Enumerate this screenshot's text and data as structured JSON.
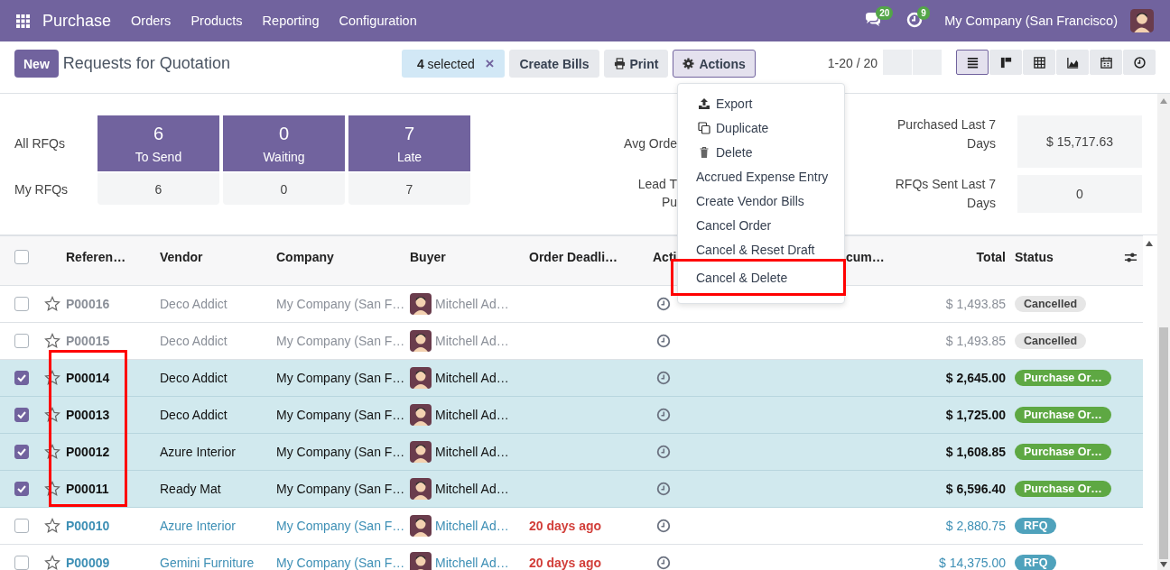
{
  "navbar": {
    "app": "Purchase",
    "menus": [
      "Orders",
      "Products",
      "Reporting",
      "Configuration"
    ],
    "messages_count": "20",
    "activities_count": "9",
    "company": "My Company (San Francisco)"
  },
  "control_panel": {
    "new_button": "New",
    "title": "Requests for Quotation",
    "selection": {
      "text": "**4** selected",
      "clear": "×"
    },
    "buttons": [
      {
        "label": "Create Bills",
        "kind": "plain",
        "open": false
      },
      {
        "label": "Print",
        "kind": "print",
        "open": false
      },
      {
        "label": "Actions",
        "kind": "actions",
        "open": true
      }
    ],
    "pager": "1-20 / 20",
    "views": [
      {
        "kind": "list",
        "selected": true
      },
      {
        "kind": "kanban",
        "selected": false
      },
      {
        "kind": "pivot",
        "selected": false
      },
      {
        "kind": "graph",
        "selected": false
      },
      {
        "kind": "calendar",
        "selected": false
      },
      {
        "kind": "activity",
        "selected": false
      }
    ]
  },
  "actions_menu": {
    "items": [
      {
        "label": "Export",
        "kind": "export",
        "marked": false
      },
      {
        "label": "Duplicate",
        "kind": "duplicate",
        "marked": false
      },
      {
        "label": "Delete",
        "kind": "delete",
        "marked": false
      },
      {
        "label": "Accrued Expense Entry",
        "kind": "plain",
        "marked": false
      },
      {
        "label": "Create Vendor Bills",
        "kind": "plain",
        "marked": false
      },
      {
        "label": "Cancel Order",
        "kind": "plain",
        "marked": false
      },
      {
        "label": "Cancel & Reset Draft",
        "kind": "plain",
        "marked": false
      },
      {
        "label": "Cancel & Delete",
        "kind": "plain",
        "marked": true
      }
    ]
  },
  "dashboard": {
    "row_labels": [
      "All RFQs",
      "My RFQs"
    ],
    "tiles": [
      {
        "count": "6",
        "label": "To Send",
        "mine": "6"
      },
      {
        "count": "0",
        "label": "Waiting",
        "mine": "0"
      },
      {
        "count": "7",
        "label": "Late",
        "mine": "7"
      }
    ],
    "partial_labels": [
      {
        "lines": [
          "Avg Orde"
        ]
      },
      {
        "lines": [
          "Lead T",
          "Pu"
        ]
      }
    ],
    "kpis": [
      {
        "label": "Purchased Last 7 Days",
        "value": "$ 15,717.63"
      },
      {
        "label": "RFQs Sent Last 7 Days",
        "value": "0"
      }
    ]
  },
  "table": {
    "select_all": false,
    "columns": [
      "Referen…",
      "Vendor",
      "Company",
      "Buyer",
      "Order Deadli…",
      "Acti",
      "cum…",
      "Total",
      "Status"
    ],
    "rows": [
      {
        "selected": false,
        "starred": false,
        "marked": false,
        "reference": "P00016",
        "vendor": "Deco Addict",
        "company": "My Company (San F…",
        "buyer": "Mitchell Ad…",
        "total": "$ 1,493.85",
        "status": "Cancelled",
        "kind": "cancelled"
      },
      {
        "selected": false,
        "starred": false,
        "marked": false,
        "reference": "P00015",
        "vendor": "Deco Addict",
        "company": "My Company (San F…",
        "buyer": "Mitchell Ad…",
        "total": "$ 1,493.85",
        "status": "Cancelled",
        "kind": "cancelled"
      },
      {
        "selected": true,
        "starred": false,
        "marked": true,
        "reference": "P00014",
        "vendor": "Deco Addict",
        "company": "My Company (San F…",
        "buyer": "Mitchell Ad…",
        "total": "$ 2,645.00",
        "status": "Purchase Or…",
        "kind": "purchase"
      },
      {
        "selected": true,
        "starred": false,
        "marked": true,
        "reference": "P00013",
        "vendor": "Deco Addict",
        "company": "My Company (San F…",
        "buyer": "Mitchell Ad…",
        "total": "$ 1,725.00",
        "status": "Purchase Or…",
        "kind": "purchase"
      },
      {
        "selected": true,
        "starred": false,
        "marked": true,
        "reference": "P00012",
        "vendor": "Azure Interior",
        "company": "My Company (San F…",
        "buyer": "Mitchell Ad…",
        "total": "$ 1,608.85",
        "status": "Purchase Or…",
        "kind": "purchase"
      },
      {
        "selected": true,
        "starred": false,
        "marked": true,
        "reference": "P00011",
        "vendor": "Ready Mat",
        "company": "My Company (San F…",
        "buyer": "Mitchell Ad…",
        "total": "$ 6,596.40",
        "status": "Purchase Or…",
        "kind": "purchase"
      },
      {
        "selected": false,
        "starred": false,
        "marked": false,
        "reference": "P00010",
        "vendor": "Azure Interior",
        "company": "My Company (San F…",
        "buyer": "Mitchell Ad…",
        "deadline": "20 days ago",
        "total": "$ 2,880.75",
        "status": "RFQ",
        "kind": "rfq"
      },
      {
        "selected": false,
        "starred": false,
        "marked": false,
        "reference": "P00009",
        "vendor": "Gemini Furniture",
        "company": "My Company (San F…",
        "buyer": "Mitchell Ad…",
        "deadline": "20 days ago",
        "total": "$ 14,375.00",
        "status": "RFQ",
        "kind": "rfq"
      }
    ]
  }
}
